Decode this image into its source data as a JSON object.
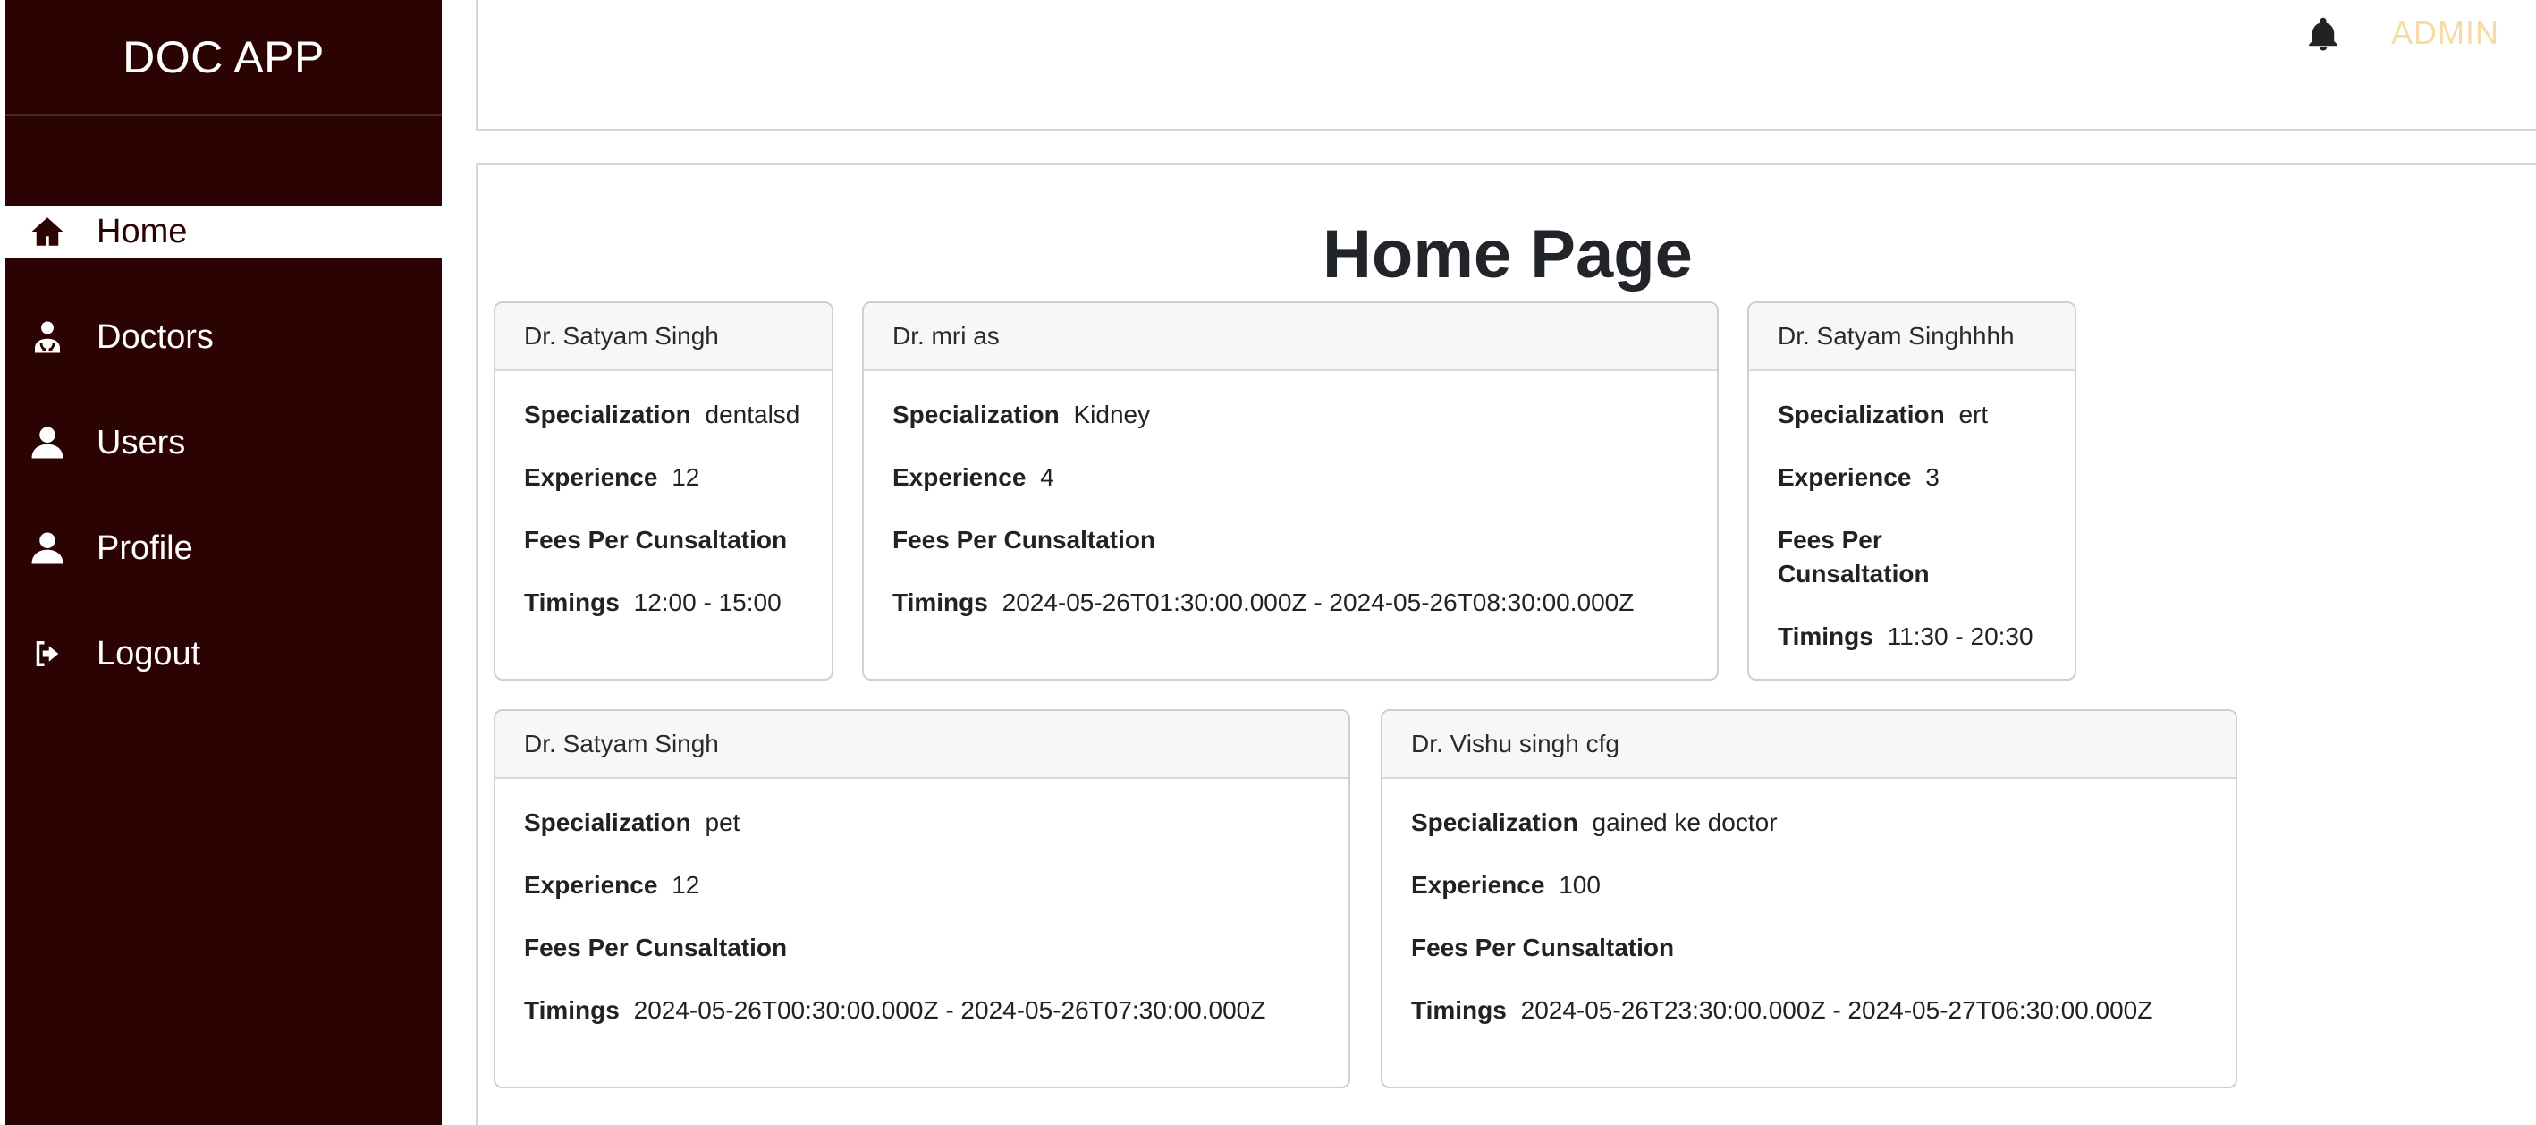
{
  "app": {
    "title": "DOC APP"
  },
  "sidebar": {
    "items": [
      {
        "label": "Home",
        "icon": "home-icon",
        "active": true
      },
      {
        "label": "Doctors",
        "icon": "doctor-icon",
        "active": false
      },
      {
        "label": "Users",
        "icon": "user-icon",
        "active": false
      },
      {
        "label": "Profile",
        "icon": "user-icon",
        "active": false
      },
      {
        "label": "Logout",
        "icon": "logout-icon",
        "active": false
      }
    ]
  },
  "header": {
    "role": "ADMIN"
  },
  "main": {
    "title": "Home Page"
  },
  "labels": {
    "specialization": "Specialization",
    "experience": "Experience",
    "fees": "Fees Per Cunsaltation",
    "timings": "Timings"
  },
  "doctors": [
    {
      "name": "Dr. Satyam Singh",
      "specialization": "dentalsd",
      "experience": "12",
      "fees": "",
      "timings": "12:00 - 15:00"
    },
    {
      "name": "Dr. mri as",
      "specialization": "Kidney",
      "experience": "4",
      "fees": "",
      "timings": "2024-05-26T01:30:00.000Z - 2024-05-26T08:30:00.000Z"
    },
    {
      "name": "Dr. Satyam Singhhhh",
      "specialization": "ert",
      "experience": "3",
      "fees": "",
      "timings": "11:30 - 20:30"
    },
    {
      "name": "Dr. Satyam Singh",
      "specialization": "pet",
      "experience": "12",
      "fees": "",
      "timings": "2024-05-26T00:30:00.000Z - 2024-05-26T07:30:00.000Z"
    },
    {
      "name": "Dr. Vishu singh cfg",
      "specialization": "gained ke doctor",
      "experience": "100",
      "fees": "",
      "timings": "2024-05-26T23:30:00.000Z - 2024-05-27T06:30:00.000Z"
    }
  ],
  "colors": {
    "sidebar_bg": "#2b0303",
    "admin_text": "#f7dba7"
  }
}
